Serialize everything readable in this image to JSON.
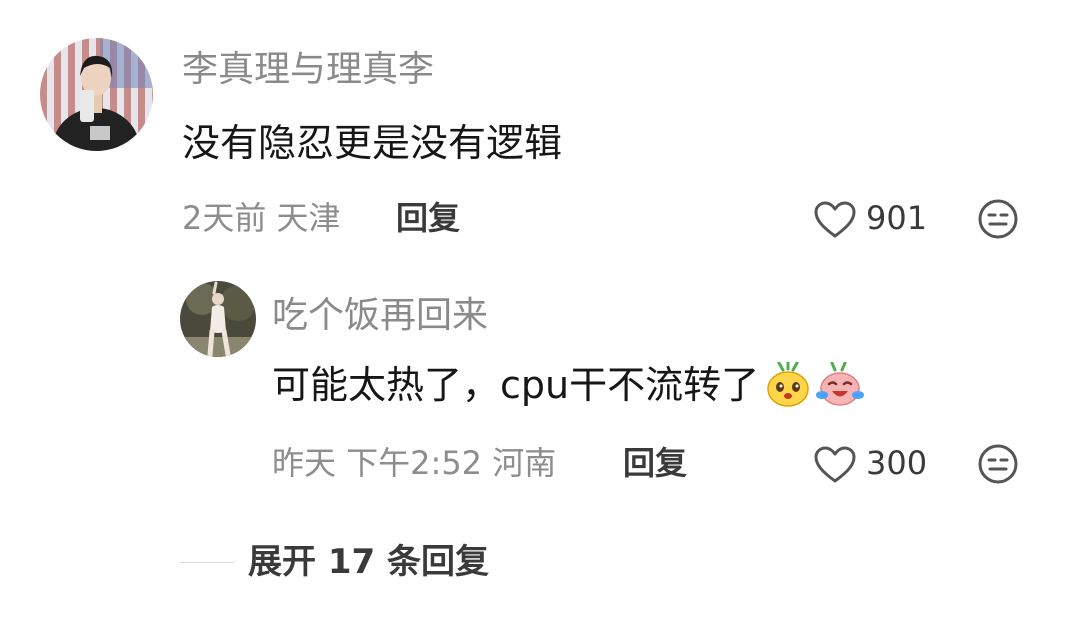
{
  "comments": [
    {
      "username": "李真理与理真李",
      "text": "没有隐忍更是没有逻辑",
      "meta": "2天前 天津",
      "reply_label": "回复",
      "likes": "901",
      "avatar_icon": "user-photo-avatar",
      "like_icon": "heart-outline-icon",
      "dislike_icon": "neutral-face-icon"
    }
  ],
  "replies": [
    {
      "username": "吃个饭再回来",
      "text": "可能太热了，cpu干不流转了",
      "emojis": [
        "pineapple-face-emoji",
        "crying-laughing-face-emoji"
      ],
      "meta": "昨天 下午2:52 河南",
      "reply_label": "回复",
      "likes": "300",
      "avatar_icon": "user-photo-avatar",
      "like_icon": "heart-outline-icon",
      "dislike_icon": "neutral-face-icon"
    }
  ],
  "expand": {
    "label": "展开 17 条回复"
  },
  "colors": {
    "username": "#8a8a8a",
    "text": "#161616",
    "meta": "#8d8d8d",
    "action": "#3a3a3a"
  }
}
